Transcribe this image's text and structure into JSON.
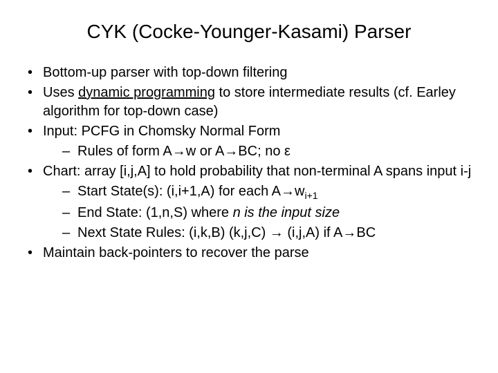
{
  "title": "CYK (Cocke-Younger-Kasami) Parser",
  "bullets": {
    "b1": "Bottom-up parser with top-down filtering",
    "b2a": "Uses ",
    "b2b": "dynamic programming",
    "b2c": " to store intermediate results (cf. Earley algorithm for top-down case)",
    "b3": "Input: PCFG in Chomsky Normal Form",
    "b3s1": "Rules of form A→w or A→BC; no ε",
    "b4": "Chart: array [i,j,A] to hold probability that non-terminal A spans input i-j",
    "b4s1a": "Start State(s): (i,i+1,A) for each A→w",
    "b4s1b": "i+1",
    "b4s2a": "End State: (1,n,S) where ",
    "b4s2b": "n is the input size",
    "b4s3": "Next State Rules: (i,k,B) (k,j,C) → (i,j,A) if A→BC",
    "b5": "Maintain back-pointers to recover the parse"
  }
}
